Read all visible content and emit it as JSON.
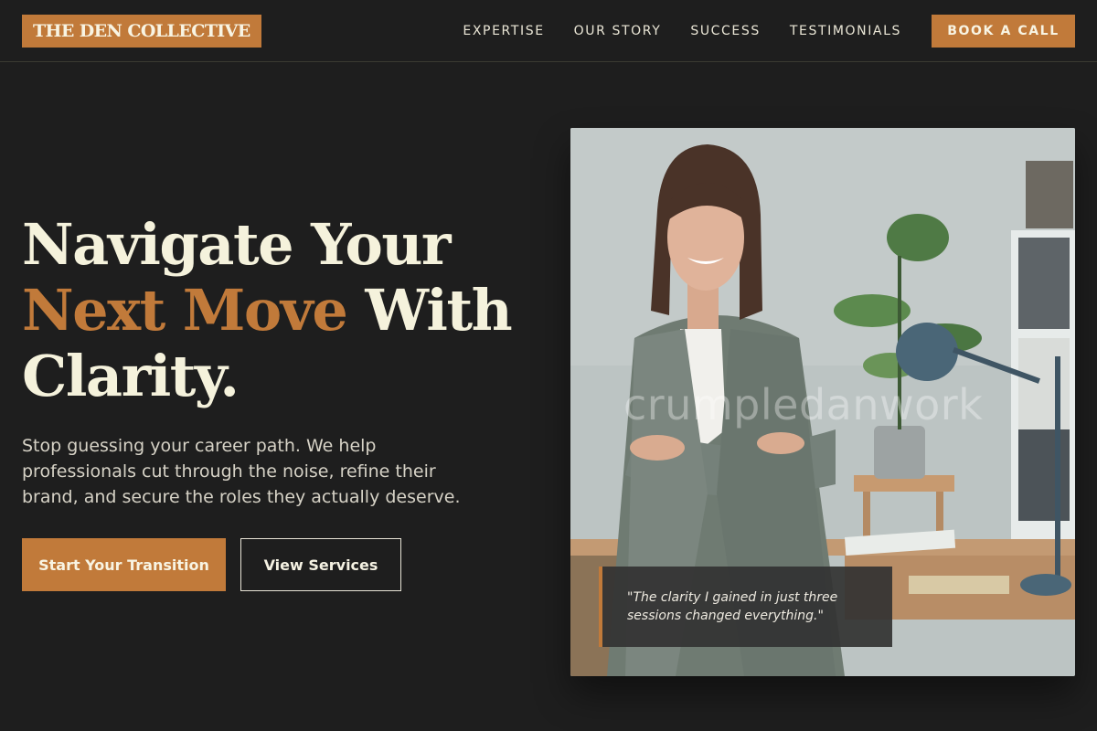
{
  "brand": {
    "name": "THE DEN COLLECTIVE"
  },
  "nav": {
    "items": [
      {
        "label": "EXPERTISE"
      },
      {
        "label": "OUR STORY"
      },
      {
        "label": "SUCCESS"
      },
      {
        "label": "TESTIMONIALS"
      }
    ],
    "cta_label": "BOOK A CALL"
  },
  "hero": {
    "headline_part1": "Navigate Your",
    "headline_accent": "Next Move",
    "headline_part2": "With",
    "headline_part3": "Clarity.",
    "subtext": "Stop guessing your career path. We help professionals cut through the noise, refine their brand, and secure the roles they actually deserve.",
    "primary_button": "Start Your Transition",
    "secondary_button": "View Services",
    "photo_watermark": "crumpledanwork",
    "quote": "\"The clarity I gained in just three sessions changed everything.\""
  },
  "colors": {
    "background": "#1e1e1e",
    "accent": "#c17a3a",
    "text": "#f5f2dc"
  }
}
